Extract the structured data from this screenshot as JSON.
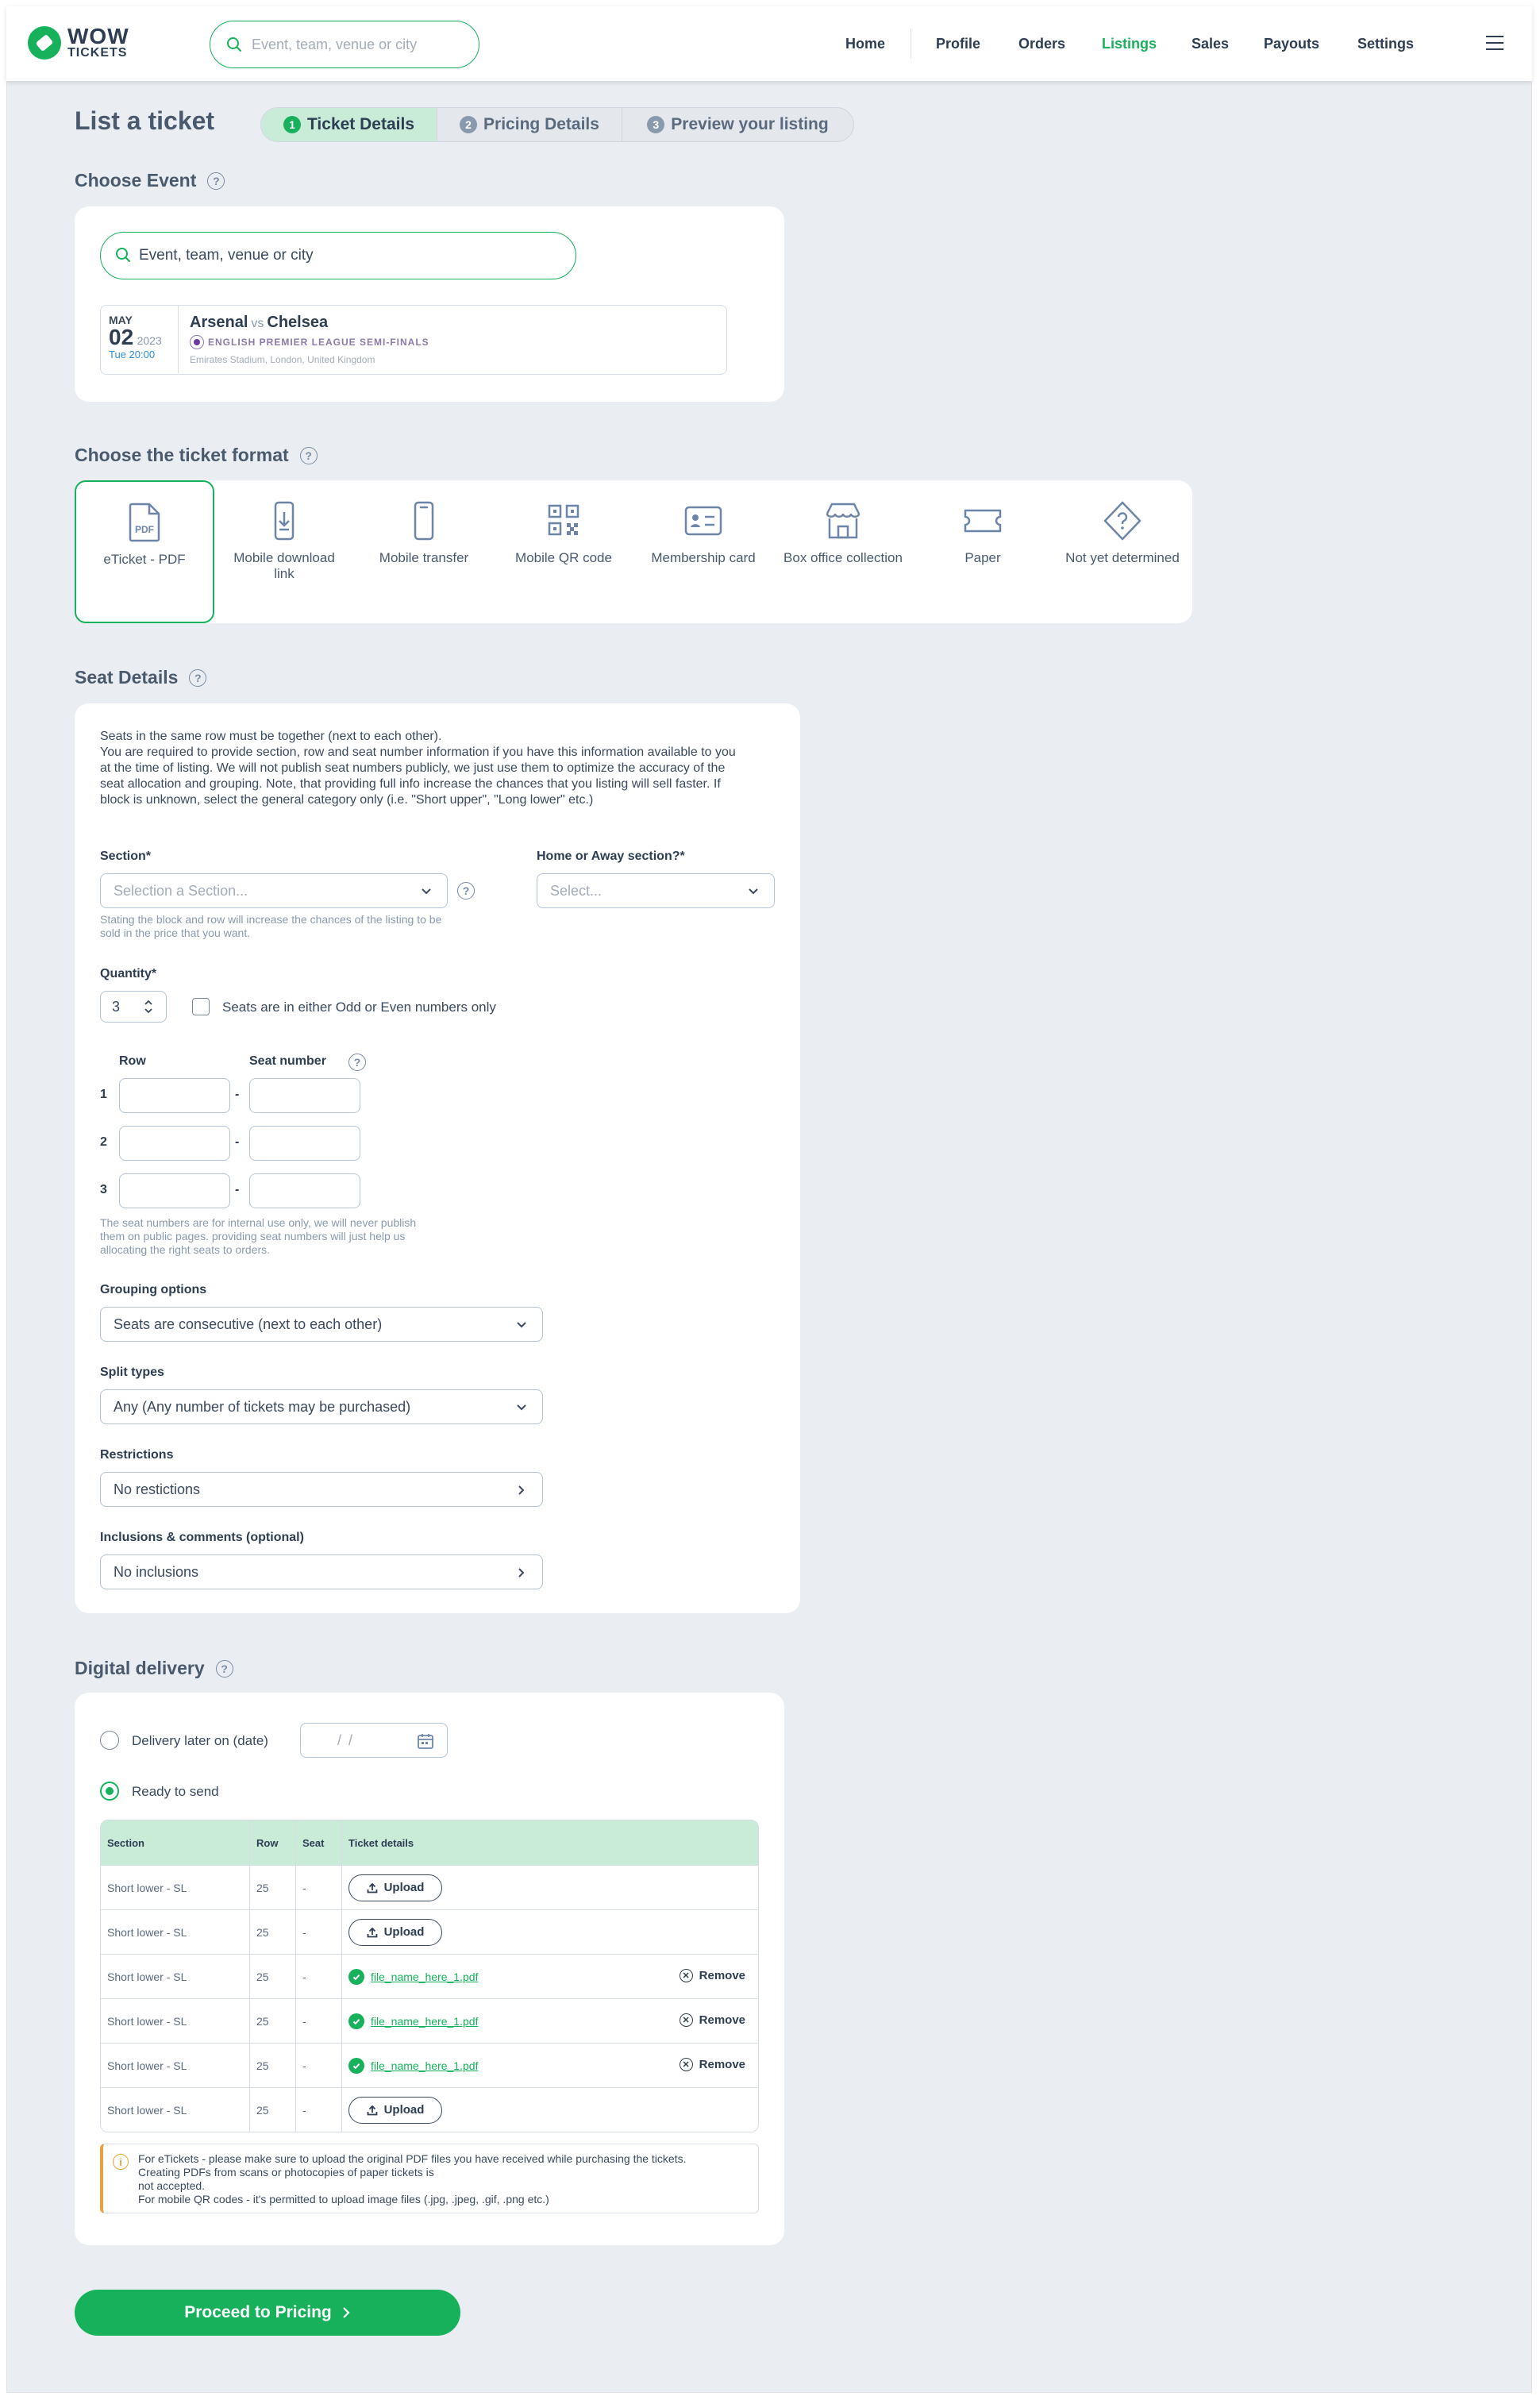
{
  "header": {
    "logo_line1": "WOW",
    "logo_line2": "TICKETS",
    "search_placeholder": "Event, team, venue or city",
    "nav": [
      "Home",
      "Profile",
      "Orders",
      "Listings",
      "Sales",
      "Payouts",
      "Settings"
    ],
    "active_nav": "Listings"
  },
  "page": {
    "title": "List a ticket",
    "steps": [
      {
        "num": "1",
        "label": "Ticket Details"
      },
      {
        "num": "2",
        "label": "Pricing Details"
      },
      {
        "num": "3",
        "label": "Preview your listing"
      }
    ]
  },
  "choose_event": {
    "title": "Choose Event",
    "search_value": "Event, team, venue or city",
    "event": {
      "month": "MAY",
      "day": "02",
      "year": "2023",
      "time": "Tue 20:00",
      "home": "Arsenal",
      "vs": "vs",
      "away": "Chelsea",
      "league": "ENGLISH PREMIER LEAGUE SEMI-FINALS",
      "venue": "Emirates Stadium, London, United Kingdom"
    }
  },
  "ticket_format": {
    "title": "Choose the ticket format",
    "options": [
      "eTicket - PDF",
      "Mobile download link",
      "Mobile transfer",
      "Mobile QR code",
      "Membership card",
      "Box office collection",
      "Paper",
      "Not yet determined"
    ],
    "selected": "eTicket - PDF",
    "pdf_badge": "PDF"
  },
  "seat_details": {
    "title": "Seat Details",
    "intro_line1": "Seats in the same row must be together (next to each other).",
    "intro_line2": "You are required to provide section, row and seat number information if you have this information available to you at the time of listing. We will not publish seat numbers publicly, we just use them to optimize the accuracy of the seat allocation and grouping. Note, that providing full info increase the chances that you listing will sell faster. If block is unknown, select the general category only (i.e. \"Short upper\", \"Long lower\" etc.)",
    "section_label": "Section*",
    "section_placeholder": "Selection a Section...",
    "section_hint": "Stating the block and row will increase the chances of the listing to be sold in the price that you want.",
    "home_away_label": "Home or Away section?*",
    "home_away_placeholder": "Select...",
    "quantity_label": "Quantity*",
    "quantity_value": "3",
    "odd_even_label": "Seats are in either Odd or Even numbers only",
    "row_label": "Row",
    "seat_number_label": "Seat number",
    "rows": [
      "1",
      "2",
      "3"
    ],
    "seat_hint": "The seat numbers are for internal use only, we will never publish them on public pages. providing seat numbers will just help us allocating the right seats to orders.",
    "grouping_label": "Grouping options",
    "grouping_value": "Seats are consecutive (next to each other)",
    "split_label": "Split types",
    "split_value": "Any (Any number of tickets may be purchased)",
    "restrictions_label": "Restrictions",
    "restrictions_value": "No restictions",
    "inclusions_label": "Inclusions & comments (optional)",
    "inclusions_value": "No inclusions"
  },
  "digital_delivery": {
    "title": "Digital delivery",
    "later_label": "Delivery later on (date)",
    "date_placeholder": "/    /",
    "ready_label": "Ready to send",
    "columns": [
      "Section",
      "Row",
      "Seat",
      "Ticket details"
    ],
    "upload_label": "Upload",
    "remove_label": "Remove",
    "rows": [
      {
        "section": "Short lower - SL",
        "row": "25",
        "seat": "-",
        "file": ""
      },
      {
        "section": "Short lower - SL",
        "row": "25",
        "seat": "-",
        "file": ""
      },
      {
        "section": "Short lower - SL",
        "row": "25",
        "seat": "-",
        "file": "file_name_here_1.pdf"
      },
      {
        "section": "Short lower - SL",
        "row": "25",
        "seat": "-",
        "file": "file_name_here_1.pdf"
      },
      {
        "section": "Short lower - SL",
        "row": "25",
        "seat": "-",
        "file": "file_name_here_1.pdf"
      },
      {
        "section": "Short lower - SL",
        "row": "25",
        "seat": "-",
        "file": ""
      }
    ],
    "notice_line1": "For eTickets - please make sure to upload the original PDF files you have received while purchasing the tickets.",
    "notice_line2": "Creating PDFs from scans or photocopies of paper tickets is",
    "notice_line3": "not accepted.",
    "notice_line4": "For mobile QR codes - it's permitted to upload image files (.jpg, .jpeg, .gif, .png etc.)",
    "notice_icon": "i"
  },
  "proceed_label": "Proceed to Pricing",
  "colors": {
    "brand": "#17b15b",
    "background": "#eaeef2",
    "active_step": "#c9ecd9",
    "warning": "#e5a23a"
  }
}
